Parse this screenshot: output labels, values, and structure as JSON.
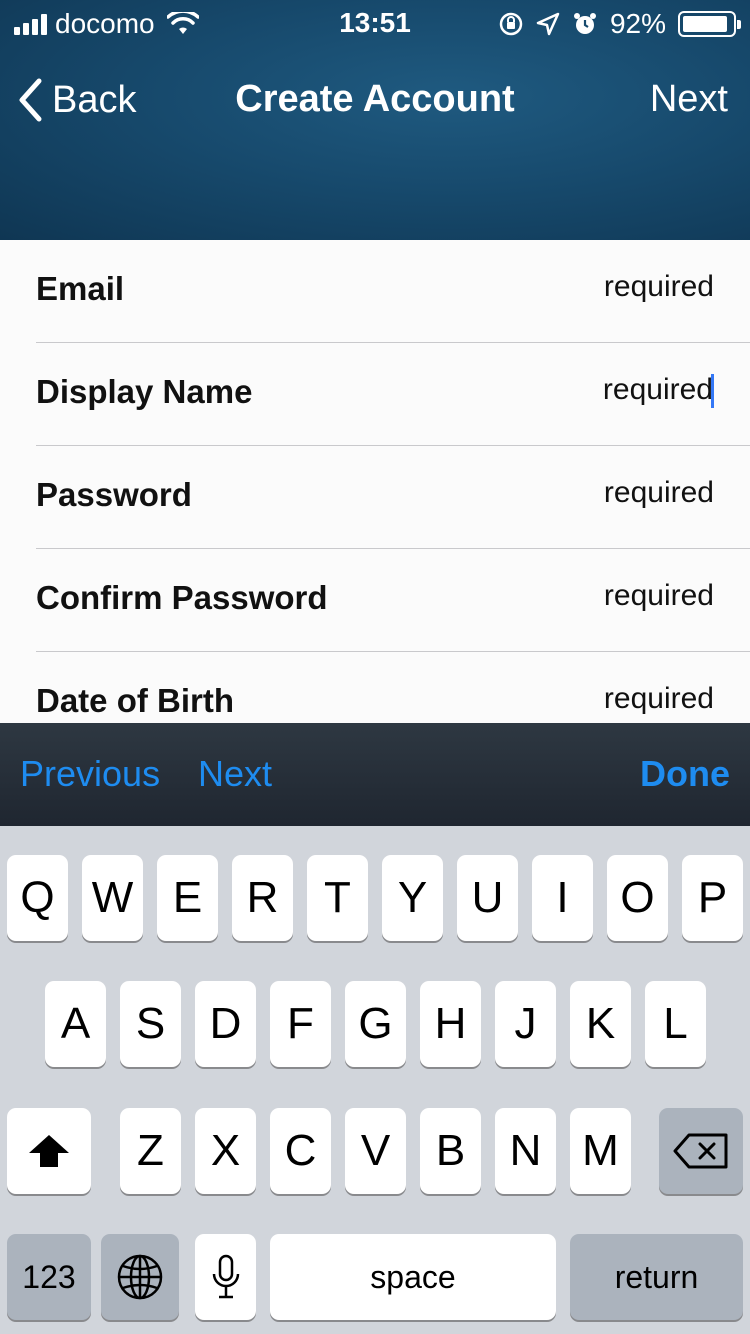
{
  "status_bar": {
    "carrier": "docomo",
    "time": "13:51",
    "battery": "92%",
    "battery_level": 0.92
  },
  "nav": {
    "back_label": "Back",
    "title": "Create Account",
    "next_label": "Next"
  },
  "form": {
    "rows": [
      {
        "label": "Email",
        "value": "required"
      },
      {
        "label": "Display Name",
        "value": "required"
      },
      {
        "label": "Password",
        "value": "required"
      },
      {
        "label": "Confirm Password",
        "value": "required"
      },
      {
        "label": "Date of Birth",
        "value": "required"
      }
    ]
  },
  "accessory": {
    "previous": "Previous",
    "next": "Next",
    "done": "Done"
  },
  "keyboard": {
    "row1": [
      "Q",
      "W",
      "E",
      "R",
      "T",
      "Y",
      "U",
      "I",
      "O",
      "P"
    ],
    "row2": [
      "A",
      "S",
      "D",
      "F",
      "G",
      "H",
      "J",
      "K",
      "L"
    ],
    "row3": [
      "Z",
      "X",
      "C",
      "V",
      "B",
      "N",
      "M"
    ],
    "numbers": "123",
    "space": "space",
    "return": "return"
  },
  "colors": {
    "accent": "#1e8cf0",
    "header": "#174a6d",
    "keyboard_bg": "#d1d5db"
  }
}
